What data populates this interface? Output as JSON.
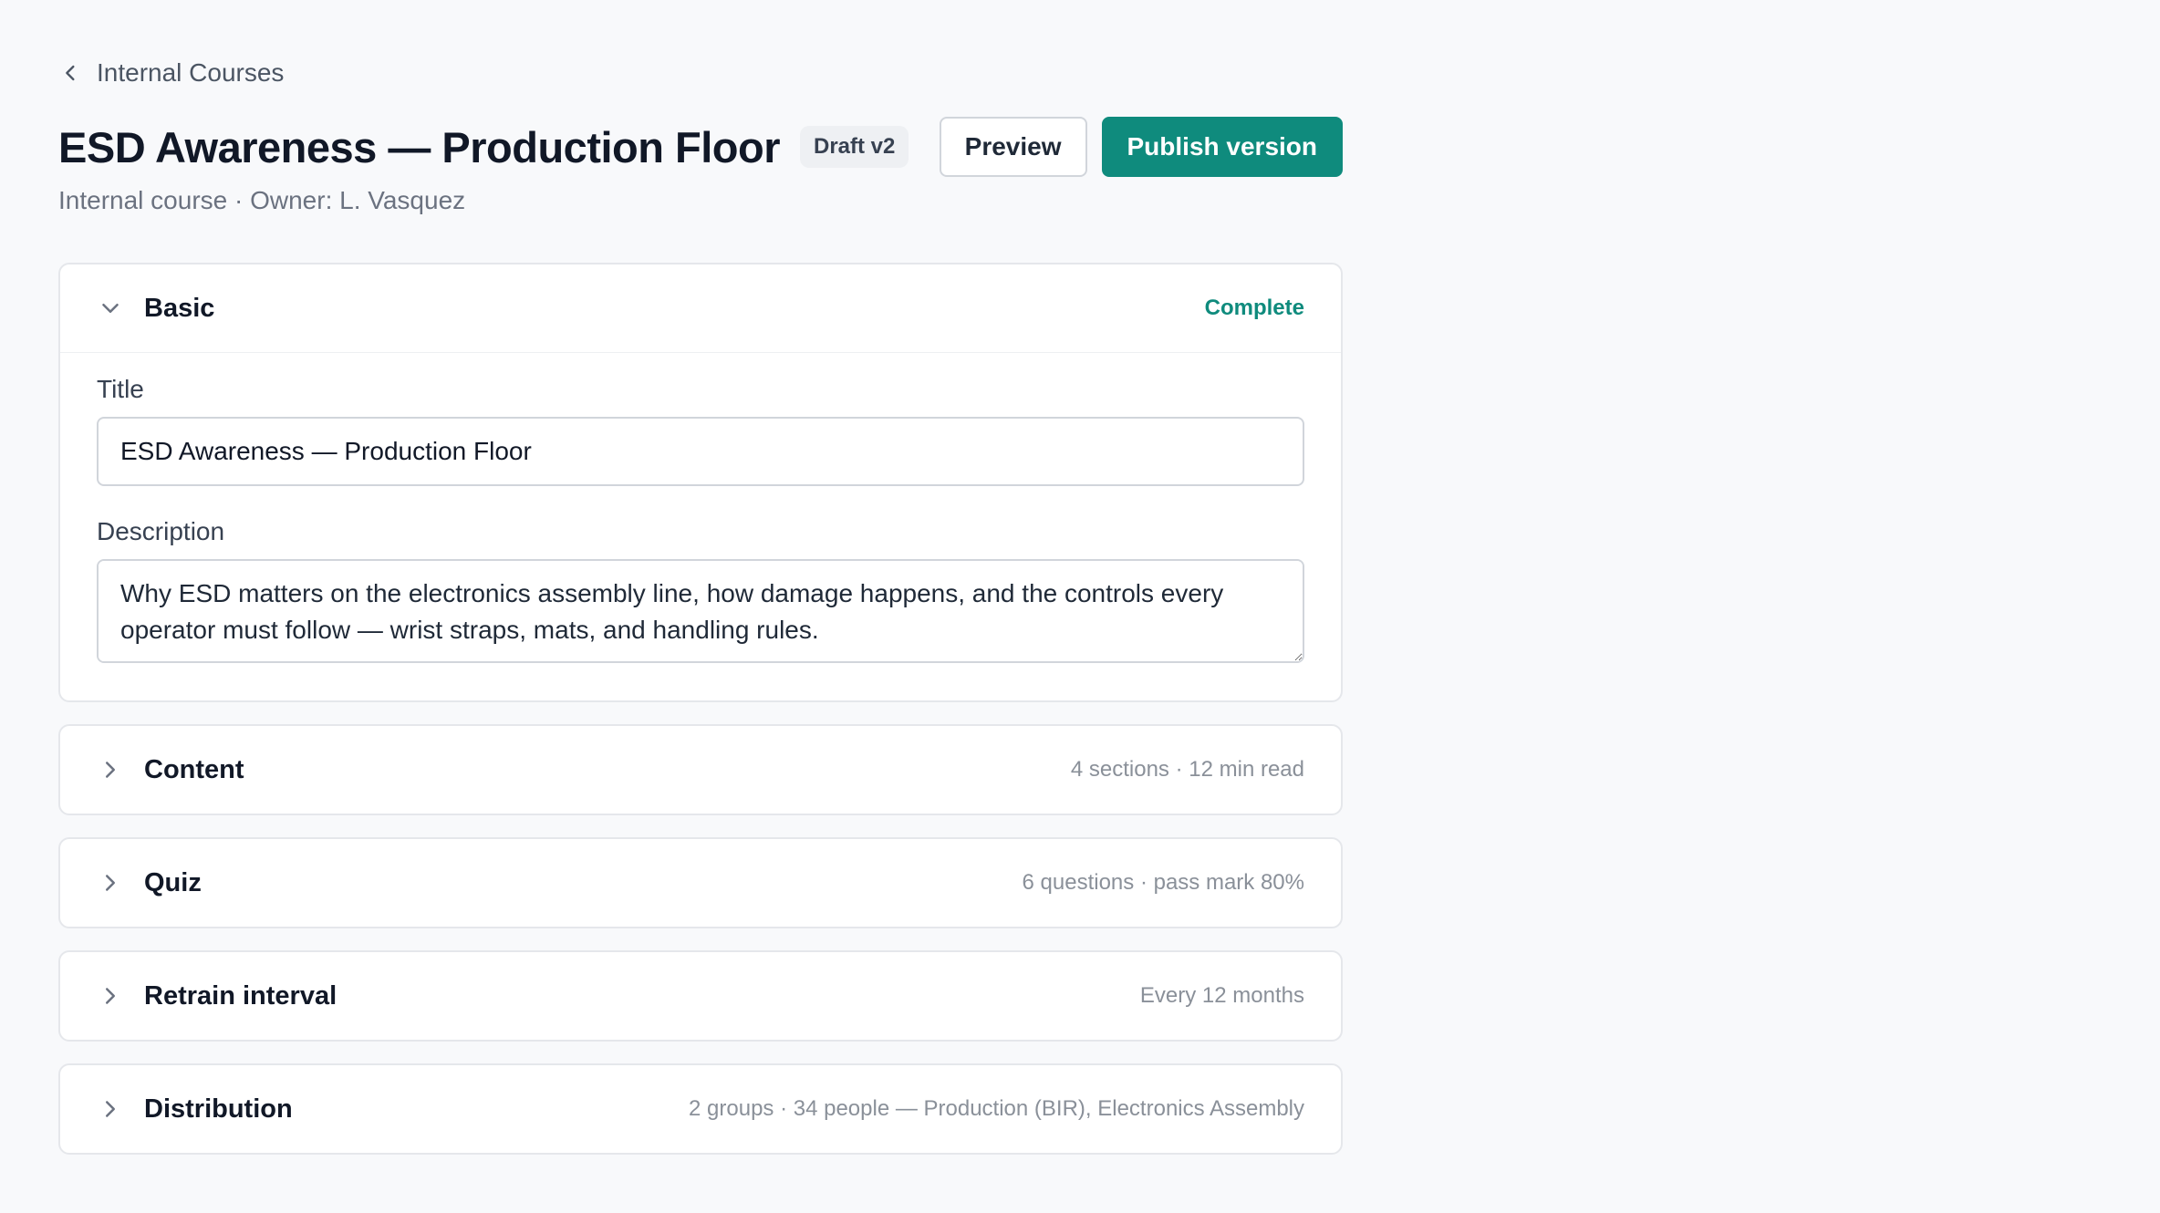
{
  "breadcrumb": {
    "label": "Internal Courses"
  },
  "header": {
    "title": "ESD Awareness — Production Floor",
    "badge": "Draft v2",
    "preview_label": "Preview",
    "publish_label": "Publish version",
    "subtitle": "Internal course · Owner: L. Vasquez"
  },
  "colors": {
    "accent": "#0f8b7d",
    "background": "#f8f9fb"
  },
  "sections": {
    "basic": {
      "name": "Basic",
      "status": "Complete",
      "title_label": "Title",
      "title_value": "ESD Awareness — Production Floor",
      "description_label": "Description",
      "description_value": "Why ESD matters on the electronics assembly line, how damage happens, and the controls every operator must follow — wrist straps, mats, and handling rules."
    },
    "content": {
      "name": "Content",
      "summary": "4 sections · 12 min read"
    },
    "quiz": {
      "name": "Quiz",
      "summary": "6 questions · pass mark 80%"
    },
    "retrain": {
      "name": "Retrain interval",
      "summary": "Every 12 months"
    },
    "distribution": {
      "name": "Distribution",
      "summary": "2 groups · 34 people — Production (BIR), Electronics Assembly"
    }
  }
}
